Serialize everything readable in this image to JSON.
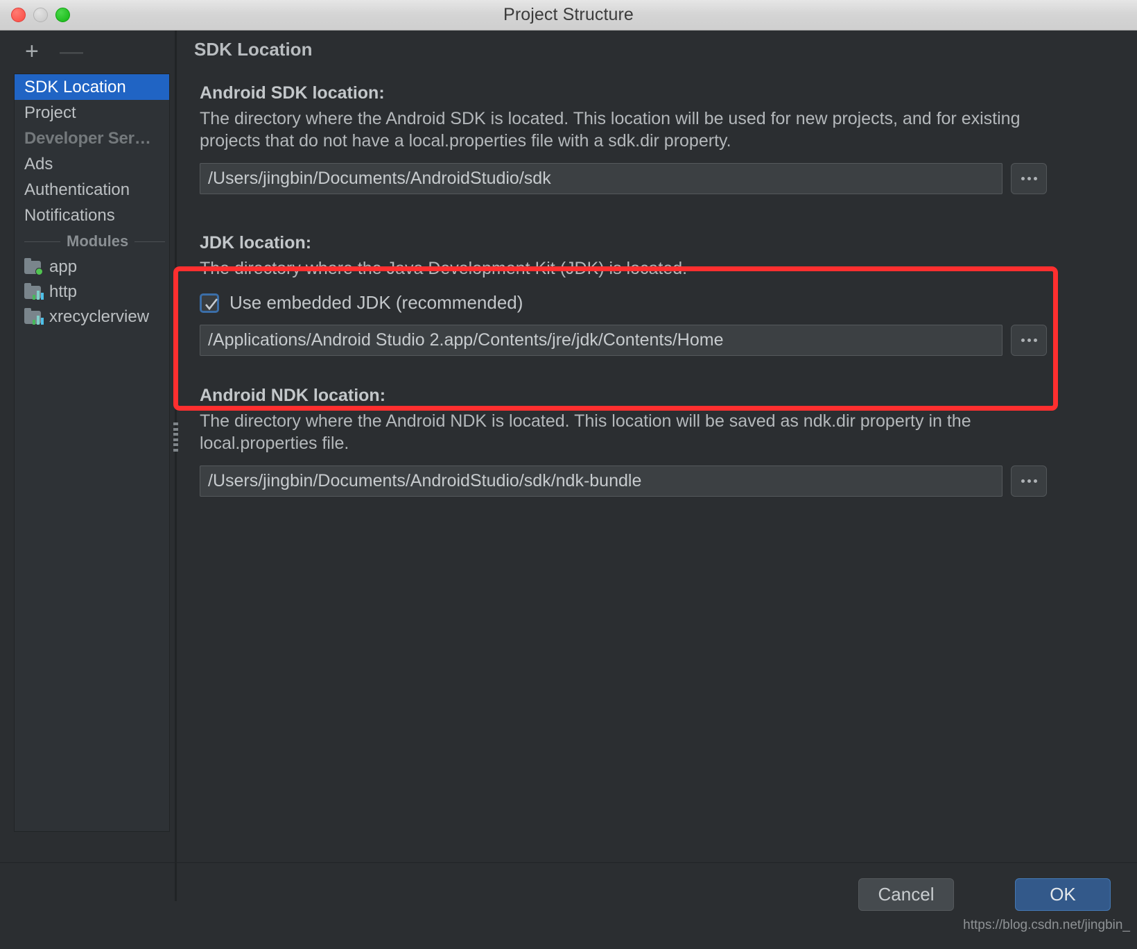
{
  "window": {
    "title": "Project Structure",
    "controls": {
      "close": "close-button",
      "minimize": "minimize-button",
      "maximize": "maximize-button"
    }
  },
  "sidebar": {
    "toolbar": {
      "add_label": "+",
      "remove_label": "—"
    },
    "items": [
      {
        "label": "SDK Location",
        "state": "selected"
      },
      {
        "label": "Project",
        "state": "normal"
      },
      {
        "label": "Developer Ser…",
        "state": "disabled"
      },
      {
        "label": "Ads",
        "state": "normal"
      },
      {
        "label": "Authentication",
        "state": "normal"
      },
      {
        "label": "Notifications",
        "state": "normal"
      }
    ],
    "modules_separator": "Modules",
    "modules": [
      {
        "label": "app",
        "icon": "folder-green-dot-icon"
      },
      {
        "label": "http",
        "icon": "folder-library-icon"
      },
      {
        "label": "xrecyclerview",
        "icon": "folder-library-icon"
      }
    ]
  },
  "main": {
    "page_title": "SDK Location",
    "sections": [
      {
        "heading": "Android SDK location:",
        "description": "The directory where the Android SDK is located. This location will be used for new projects, and for existing projects that do not have a local.properties file with a sdk.dir property.",
        "value": "/Users/jingbin/Documents/AndroidStudio/sdk",
        "browse_label": "..."
      },
      {
        "heading": "JDK location:",
        "description": "The directory where the Java Development Kit (JDK) is located.",
        "checkbox_label": "Use embedded JDK (recommended)",
        "checkbox_checked": true,
        "value": "/Applications/Android Studio 2.app/Contents/jre/jdk/Contents/Home",
        "browse_label": "..."
      },
      {
        "heading": "Android NDK location:",
        "description": "The directory where the Android NDK is located. This location will be saved as ndk.dir property in the local.properties file.",
        "value": "/Users/jingbin/Documents/AndroidStudio/sdk/ndk-bundle",
        "browse_label": "..."
      }
    ]
  },
  "footer": {
    "cancel_label": "Cancel",
    "ok_label": "OK"
  },
  "watermark": "https://blog.csdn.net/jingbin_",
  "colors": {
    "accent_selection": "#2064c4",
    "highlight_box": "#ff2f2f",
    "ok_button": "#33598a",
    "window_bg": "#2b2e31"
  }
}
